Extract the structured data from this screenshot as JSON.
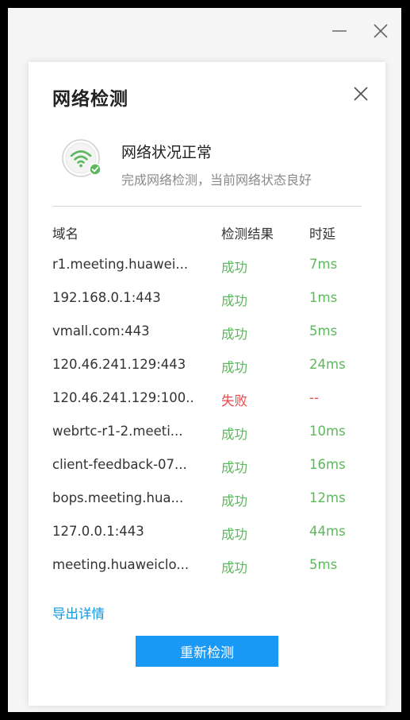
{
  "dialog": {
    "title": "网络检测"
  },
  "status": {
    "title": "网络状况正常",
    "subtitle": "完成网络检测，当前网络状态良好",
    "icon": "wifi-ok-icon",
    "ok_color": "#5cb85c"
  },
  "table": {
    "headers": {
      "domain": "域名",
      "result": "检测结果",
      "latency": "时延"
    },
    "rows": [
      {
        "domain": "r1.meeting.huawei...",
        "result": "成功",
        "latency": "7ms",
        "status": "ok"
      },
      {
        "domain": "192.168.0.1:443",
        "result": "成功",
        "latency": "1ms",
        "status": "ok"
      },
      {
        "domain": "vmall.com:443",
        "result": "成功",
        "latency": "5ms",
        "status": "ok"
      },
      {
        "domain": "120.46.241.129:443",
        "result": "成功",
        "latency": "24ms",
        "status": "ok"
      },
      {
        "domain": "120.46.241.129:100...",
        "result": "失败",
        "latency": "--",
        "status": "fail"
      },
      {
        "domain": "webrtc-r1-2.meeti...",
        "result": "成功",
        "latency": "10ms",
        "status": "ok"
      },
      {
        "domain": "client-feedback-07...",
        "result": "成功",
        "latency": "16ms",
        "status": "ok"
      },
      {
        "domain": "bops.meeting.hua...",
        "result": "成功",
        "latency": "12ms",
        "status": "ok"
      },
      {
        "domain": "127.0.0.1:443",
        "result": "成功",
        "latency": "44ms",
        "status": "ok"
      },
      {
        "domain": "meeting.huaweiclo...",
        "result": "成功",
        "latency": "5ms",
        "status": "ok"
      }
    ]
  },
  "actions": {
    "export_label": "导出详情",
    "retry_label": "重新检测"
  },
  "colors": {
    "success": "#5cb85c",
    "failure": "#e84a4a",
    "link": "#1296db",
    "primary": "#1a98f6"
  }
}
